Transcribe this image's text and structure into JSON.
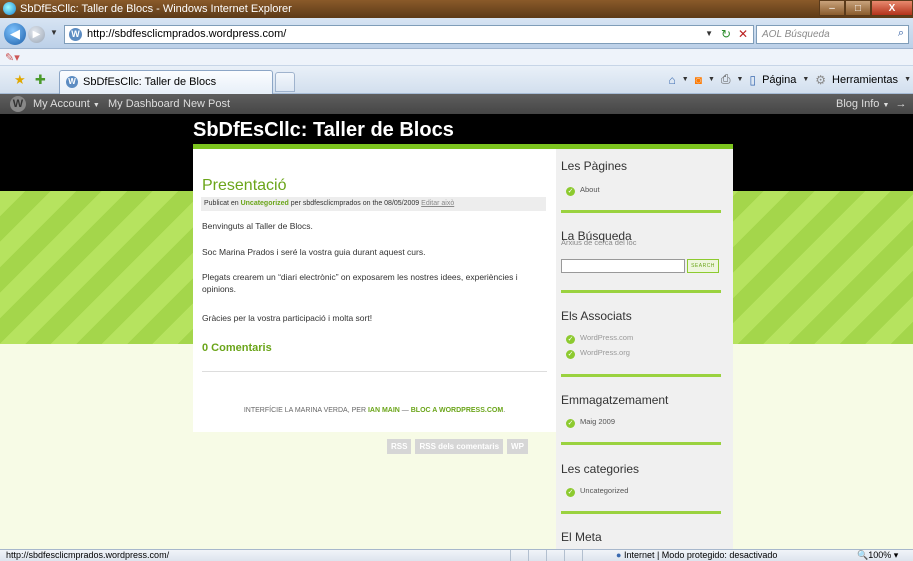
{
  "window": {
    "title": "SbDfEsCllc: Taller de Blocs - Windows Internet Explorer",
    "controls": {
      "min": "–",
      "max": "□",
      "close": "X"
    }
  },
  "address": {
    "url": "http://sbdfesclicmprados.wordpress.com/",
    "search_placeholder": "AOL Búsqueda"
  },
  "tab": {
    "title": "SbDfEsCllc: Taller de Blocs"
  },
  "toolbar": {
    "page_label": "Página",
    "tools_label": "Herramientas"
  },
  "wp_admin_bar": {
    "items": [
      "My Account",
      "My Dashboard",
      "New Post"
    ],
    "right": "Blog Info"
  },
  "blog": {
    "title": "SbDfEsCllc: Taller de Blocs"
  },
  "post": {
    "title": "Presentació",
    "meta_prefix": "Publicat en",
    "meta_category": "Uncategorized",
    "meta_suffix": "per sbdfesclicmprados on the 08/05/2009",
    "edit_link": "Editar això",
    "paragraphs": [
      "Benvinguts al Taller de Blocs.",
      "Soc Marina Prados i seré la vostra guia durant aquest curs.",
      "Plegats crearem un “diari electrònic” on exposarem les nostres idees, experiències i opinions.",
      "Gràcies per la vostra participació i molta sort!"
    ],
    "comments_link": "0 Comentaris"
  },
  "footer": {
    "prefix": "INTERFÍCIE LA MARINA VERDA, PER",
    "author": "IAN MAIN",
    "dash": "—",
    "wp": "BLOC A WORDPRESS.COM",
    "end": "."
  },
  "feeds": [
    "RSS",
    "RSS dels comentaris",
    "WP"
  ],
  "sidebar": {
    "pages_title": "Les Pàgines",
    "pages_items": [
      "About"
    ],
    "search_title": "La Búsqueda",
    "search_subtitle": "Arxius de cerca del loc",
    "search_button": "SEARCH",
    "links_title": "Els Associats",
    "links_items": [
      "WordPress.com",
      "WordPress.org"
    ],
    "archives_title": "Emmagatzemament",
    "archives_items": [
      "Maig 2009"
    ],
    "categories_title": "Les categories",
    "categories_items": [
      "Uncategorized"
    ],
    "meta_title": "El Meta"
  },
  "status": {
    "url": "http://sbdfesclicmprados.wordpress.com/",
    "zone": "Internet | Modo protegido: desactivado",
    "zoom": "100%"
  },
  "colors": {
    "accent_green": "#7cc41e",
    "link_green": "#6ba51a",
    "header_black": "#000000"
  },
  "icons": [
    "ie-logo-icon",
    "back-arrow-icon",
    "forward-arrow-icon",
    "refresh-icon",
    "stop-icon",
    "search-icon",
    "favorites-star-icon",
    "add-favorites-icon",
    "home-icon",
    "rss-feed-icon",
    "print-icon",
    "page-icon",
    "tools-gear-icon",
    "wordpress-logo-icon",
    "check-circle-icon",
    "globe-icon"
  ]
}
